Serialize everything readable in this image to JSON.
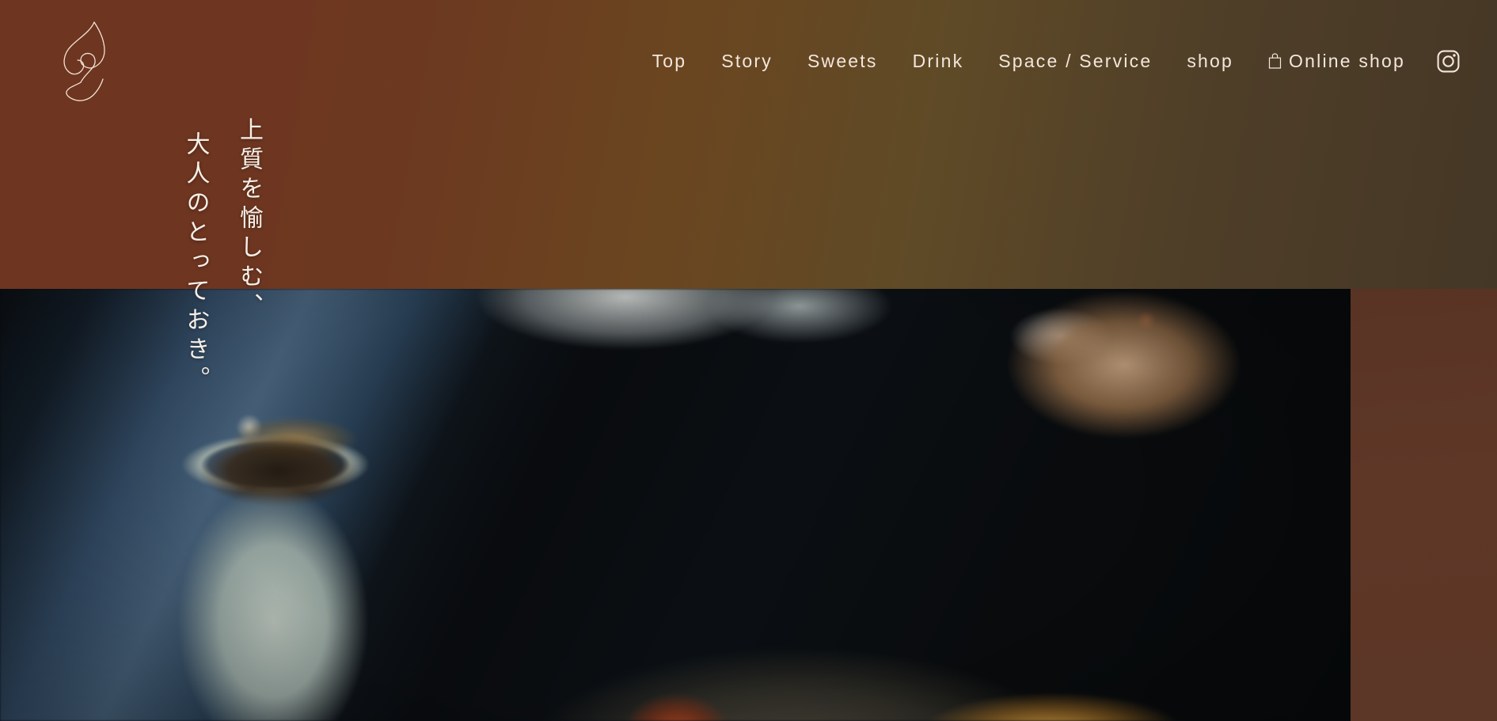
{
  "site": {
    "brand_logo_name": "leaf-line-logo",
    "accent_dark": "#6E3520",
    "accent_olive": "#453726",
    "text_cream": "#F3E7DC"
  },
  "header": {
    "logo_alt": "leaf-logo",
    "nav": [
      {
        "label": "Top",
        "name": "nav-item-top"
      },
      {
        "label": "Story",
        "name": "nav-item-story"
      },
      {
        "label": "Sweets",
        "name": "nav-item-sweets"
      },
      {
        "label": "Drink",
        "name": "nav-item-drink"
      },
      {
        "label": "Space / Service",
        "name": "nav-item-space-service"
      },
      {
        "label": "shop",
        "name": "nav-item-shop"
      }
    ],
    "online_shop": {
      "label": "Online shop",
      "icon": "shopping-bag-icon"
    },
    "instagram": {
      "icon": "instagram-icon",
      "label": "Instagram"
    }
  },
  "hero": {
    "catchcopy": {
      "line_1": "上質を愉しむ、",
      "line_2": "大人のとっておき。"
    },
    "image_alt": "blurred-photo-of-celadon-cup-with-coffee-and-dark-plate"
  }
}
